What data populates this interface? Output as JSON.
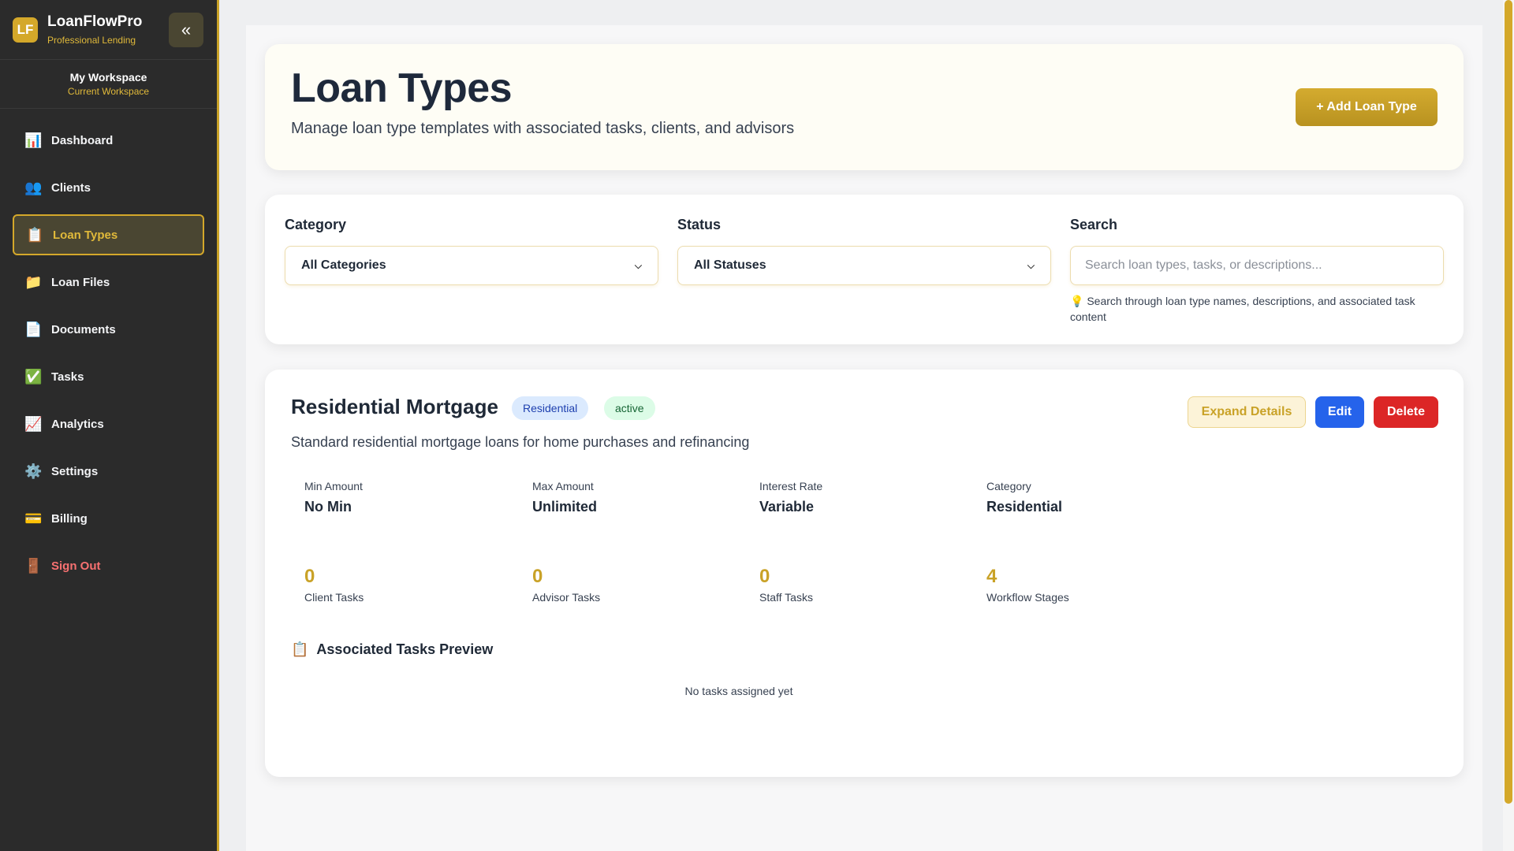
{
  "brand": {
    "logo": "LF",
    "name": "LoanFlowPro",
    "subtitle": "Professional Lending",
    "collapse_icon": "«"
  },
  "workspace": {
    "name": "My Workspace",
    "subtitle": "Current Workspace"
  },
  "nav": [
    {
      "label": "Dashboard",
      "icon": "📊"
    },
    {
      "label": "Clients",
      "icon": "👥"
    },
    {
      "label": "Loan Types",
      "icon": "📋",
      "active": true
    },
    {
      "label": "Loan Files",
      "icon": "📁"
    },
    {
      "label": "Documents",
      "icon": "📄"
    },
    {
      "label": "Tasks",
      "icon": "✅"
    },
    {
      "label": "Analytics",
      "icon": "📈"
    },
    {
      "label": "Settings",
      "icon": "⚙️"
    },
    {
      "label": "Billing",
      "icon": "💳"
    },
    {
      "label": "Sign Out",
      "icon": "🚪"
    }
  ],
  "header": {
    "title": "Loan Types",
    "subtitle": "Manage loan type templates with associated tasks, clients, and advisors",
    "add_button": "+ Add Loan Type"
  },
  "filters": {
    "category_label": "Category",
    "category_value": "All Categories",
    "status_label": "Status",
    "status_value": "All Statuses",
    "search_label": "Search",
    "search_placeholder": "Search loan types, tasks, or descriptions...",
    "search_hint_icon": "💡",
    "search_hint": "Search through loan type names, descriptions, and associated task content"
  },
  "loan_type": {
    "name": "Residential Mortgage",
    "category_badge": "Residential",
    "status_badge": "active",
    "expand_label": "Expand Details",
    "edit_label": "Edit",
    "delete_label": "Delete",
    "description": "Standard residential mortgage loans for home purchases and refinancing",
    "stats": [
      {
        "label": "Min Amount",
        "value": "No Min"
      },
      {
        "label": "Max Amount",
        "value": "Unlimited"
      },
      {
        "label": "Interest Rate",
        "value": "Variable"
      },
      {
        "label": "Category",
        "value": "Residential"
      }
    ],
    "counts": [
      {
        "value": "0",
        "label": "Client Tasks"
      },
      {
        "value": "0",
        "label": "Advisor Tasks"
      },
      {
        "value": "0",
        "label": "Staff Tasks"
      },
      {
        "value": "4",
        "label": "Workflow Stages"
      }
    ],
    "assoc_icon": "📋",
    "assoc_title": "Associated Tasks Preview",
    "no_tasks": "No tasks assigned yet"
  },
  "colors": {
    "accent": "#d4a82a",
    "sidebar": "#2b2b2b",
    "edit": "#2563eb",
    "delete": "#dc2626"
  }
}
